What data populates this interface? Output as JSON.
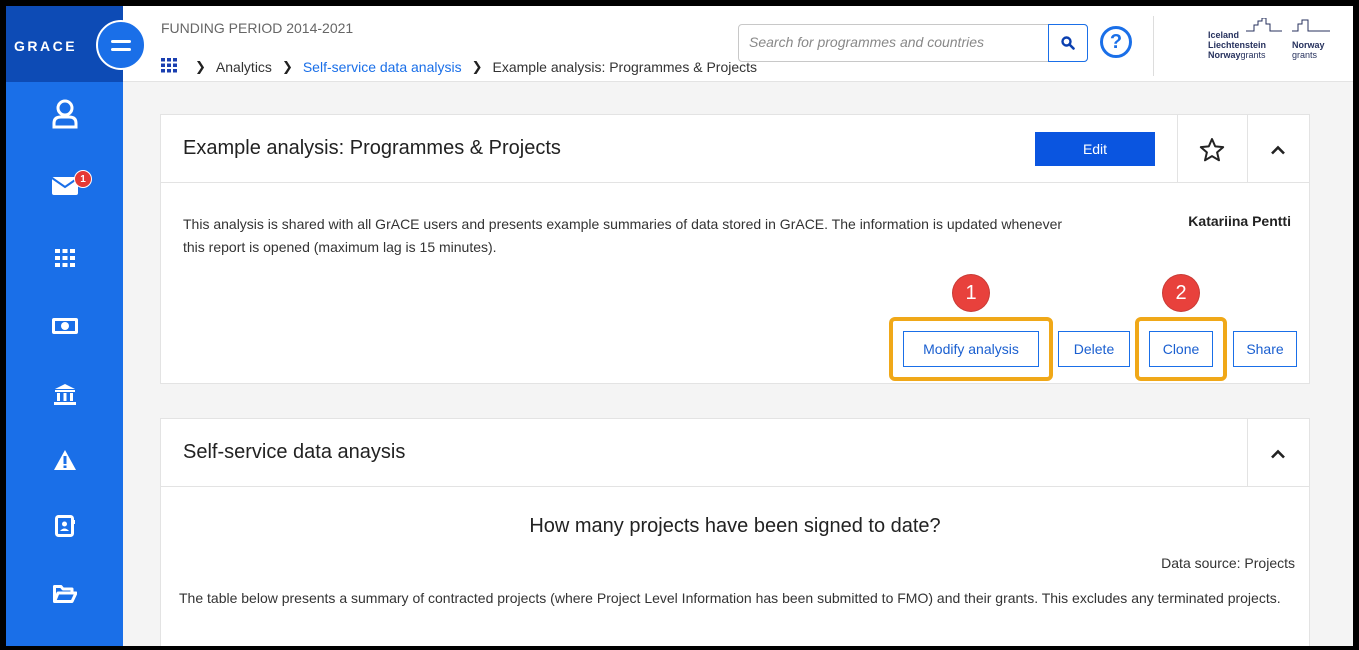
{
  "sidebar": {
    "brand": "GRACE",
    "items": [
      {
        "icon": "user-icon"
      },
      {
        "icon": "mail-icon",
        "badge": "1"
      },
      {
        "icon": "grid-icon"
      },
      {
        "icon": "money-icon"
      },
      {
        "icon": "bank-icon"
      },
      {
        "icon": "warning-icon"
      },
      {
        "icon": "contacts-icon"
      },
      {
        "icon": "folder-icon"
      }
    ]
  },
  "header": {
    "period": "FUNDING PERIOD 2014-2021",
    "breadcrumb": [
      "Analytics",
      "Self-service data analysis",
      "Example analysis: Programmes & Projects"
    ],
    "search_placeholder": "Search for programmes and countries",
    "help": "?",
    "logo": {
      "line1": "Iceland",
      "line2": "Liechtenstein",
      "line3_a": "Norway",
      "line3_b": "grants",
      "right2": "Norway",
      "right3": "grants"
    }
  },
  "analysis_card": {
    "title": "Example analysis: Programmes & Projects",
    "edit_label": "Edit",
    "description": "This analysis is shared with all GrACE users and presents example summaries of data stored in GrACE. The information is updated whenever this report is opened (maximum lag is 15 minutes).",
    "author": "Katariina Pentti",
    "actions": {
      "modify": "Modify analysis",
      "delete": "Delete",
      "clone": "Clone",
      "share": "Share"
    },
    "markers": [
      "1",
      "2"
    ]
  },
  "data_card": {
    "title": "Self-service data anaysis",
    "question": "How many projects have been signed to date?",
    "data_source": "Data source: Projects",
    "paragraph": "The table below presents a summary of contracted projects (where Project Level Information has been submitted to FMO) and their grants. This excludes any terminated projects."
  },
  "colors": {
    "sidebar": "#1a6fe8",
    "brand_bg": "#0d4bb5",
    "primary_button": "#0a55e0",
    "highlight": "#f0a818",
    "marker": "#e8413c"
  }
}
